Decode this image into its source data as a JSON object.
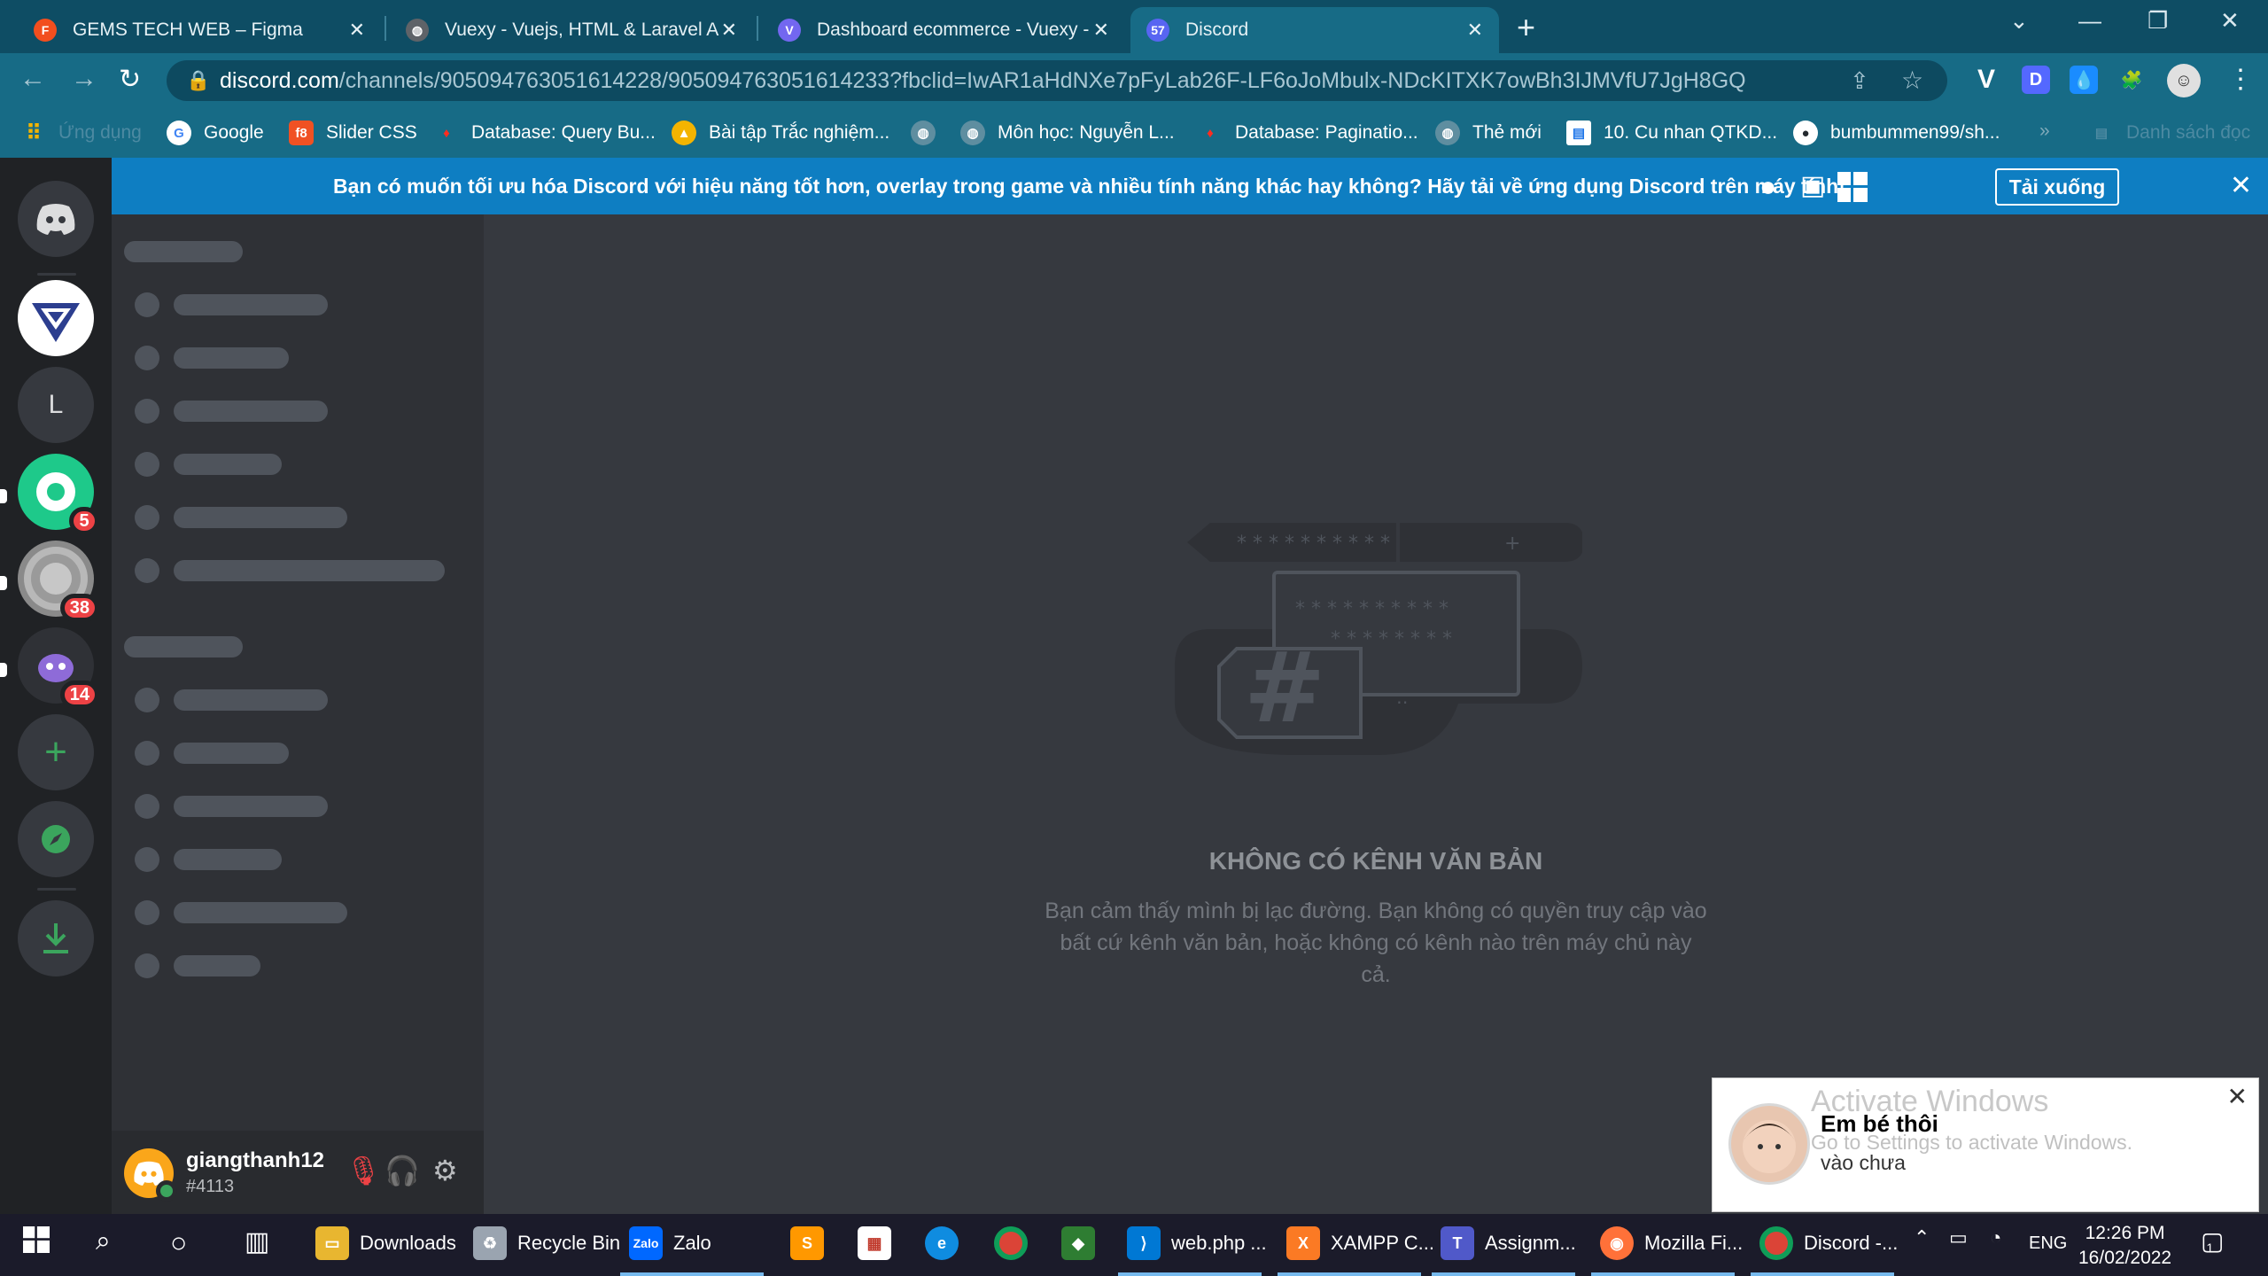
{
  "browser": {
    "tabs": [
      {
        "title": "GEMS TECH WEB – Figma",
        "icon": "figma-icon",
        "color": "#f24e1e"
      },
      {
        "title": "Vuexy - Vuejs, HTML & Laravel A",
        "icon": "globe-icon",
        "color": "#5f6368"
      },
      {
        "title": "Dashboard ecommerce - Vuexy -",
        "icon": "vuexy-icon",
        "color": "#7367f0"
      },
      {
        "title": "Discord",
        "icon": "discord-icon",
        "color": "#5865f2",
        "badge": "57"
      }
    ],
    "url_host": "discord.com",
    "url_path": "/channels/905094763051614228/905094763051614233?fbclid=IwAR1aHdNXe7pFyLab26F-LF6oJoMbulx-NDcKITXK7owBh3IJMVfU7JgH8GQ",
    "extensions": [
      "V",
      "D",
      "💧",
      "🧩"
    ],
    "bookmarks": [
      {
        "label": "Ứng dụng",
        "icon": "apps-icon"
      },
      {
        "label": "Google",
        "icon": "google-icon"
      },
      {
        "label": "Slider CSS",
        "icon": "f8-icon"
      },
      {
        "label": "Database: Query Bu...",
        "icon": "laravel-icon"
      },
      {
        "label": "Bài tập Trắc nghiệm...",
        "icon": "hat-icon"
      },
      {
        "label": "",
        "icon": "globe-icon"
      },
      {
        "label": "Môn học: Nguyễn L...",
        "icon": "globe-icon"
      },
      {
        "label": "Database: Paginatio...",
        "icon": "laravel-icon"
      },
      {
        "label": "Thẻ mới",
        "icon": "globe-icon"
      },
      {
        "label": "10. Cu nhan QTKD...",
        "icon": "doc-icon"
      },
      {
        "label": "bumbummen99/sh...",
        "icon": "github-icon"
      }
    ],
    "bookmarks_more": "»",
    "reading_list": "Danh sách đọc"
  },
  "discord": {
    "notice": {
      "text": "Bạn có muốn tối ưu hóa Discord với hiệu năng tốt hơn, overlay trong game và nhiều tính năng khác hay không? Hãy tải về ứng dụng Discord trên máy tính!",
      "button": "Tải xuống",
      "platforms": [
        "apple-icon",
        "android-icon",
        "windows-icon"
      ]
    },
    "guilds": [
      {
        "name": "home",
        "label": "",
        "badge": ""
      },
      {
        "name": "gems",
        "label": "",
        "badge": ""
      },
      {
        "name": "L",
        "label": "L",
        "badge": ""
      },
      {
        "name": "green-server",
        "label": "",
        "badge": "5"
      },
      {
        "name": "coin-server",
        "label": "",
        "badge": "38"
      },
      {
        "name": "purple-server",
        "label": "",
        "badge": "14"
      }
    ],
    "user": {
      "name": "giangthanh12",
      "tag": "#4113"
    },
    "empty": {
      "title": "KHÔNG CÓ KÊNH VĂN BẢN",
      "description": "Bạn cảm thấy mình bị lạc đường. Bạn không có quyền truy cập vào bất cứ kênh văn bản, hoặc không có kênh nào trên máy chủ này cả."
    },
    "colors": {
      "blurple": "#5865f2",
      "green": "#3ba55d",
      "red": "#ed4245",
      "notice": "#0e7ec2"
    }
  },
  "toast": {
    "name": "Em bé thôi",
    "message": "vào chưa",
    "watermark_title": "Activate Windows",
    "watermark_sub": "Go to Settings to activate Windows."
  },
  "taskbar": {
    "items": [
      {
        "label": "Downloads",
        "icon": "folder-icon"
      },
      {
        "label": "Recycle Bin",
        "icon": "recycle-bin-icon"
      },
      {
        "label": "Zalo",
        "icon": "zalo-icon"
      },
      {
        "label": "",
        "icon": "sublime-icon"
      },
      {
        "label": "",
        "icon": "app-icon"
      },
      {
        "label": "",
        "icon": "edge-icon"
      },
      {
        "label": "",
        "icon": "chrome-icon"
      },
      {
        "label": "",
        "icon": "photos-icon"
      },
      {
        "label": "web.php ...",
        "icon": "vscode-icon"
      },
      {
        "label": "XAMPP C...",
        "icon": "xampp-icon"
      },
      {
        "label": "Assignm...",
        "icon": "teams-icon"
      },
      {
        "label": "Mozilla Fi...",
        "icon": "firefox-icon"
      },
      {
        "label": "Discord -...",
        "icon": "chrome-icon"
      }
    ],
    "lang": "ENG",
    "time": "12:26 PM",
    "date": "16/02/2022",
    "notification_count": "1"
  }
}
